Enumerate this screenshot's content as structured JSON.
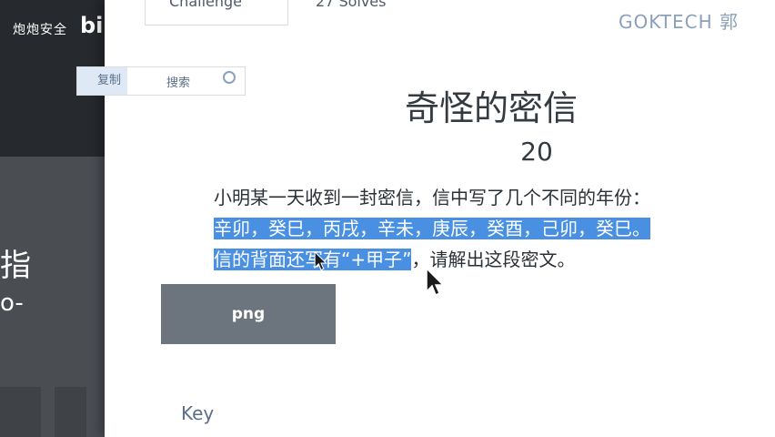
{
  "background_page": {
    "brand": "炮炮安全",
    "brand_logo": "bili",
    "heading": "指",
    "subtext": "o-"
  },
  "selection_toolbar": {
    "copy_label": "复制",
    "search_label": "搜索"
  },
  "modal": {
    "tabs": [
      {
        "label": "Challenge"
      },
      {
        "label": "27 Solves"
      }
    ],
    "watermark": "GOKTECH 郭"
  },
  "challenge": {
    "title": "奇怪的密信",
    "points": "20",
    "description": {
      "line1": "小明某一天收到一封密信，信中写了几个不同的年份：",
      "line2_highlighted": "辛卯，癸巳，丙戌，辛未，庚辰，癸酉，己卯，癸巳。",
      "line3_highlighted": "信的背面还写有“+甲子”",
      "line3_rest": "，请解出这段密文。"
    },
    "file_button": "png",
    "key_label": "Key"
  },
  "colors": {
    "highlight": "#4a90e2",
    "button_gray": "#6c757d",
    "dark_bg": "#26292d"
  }
}
